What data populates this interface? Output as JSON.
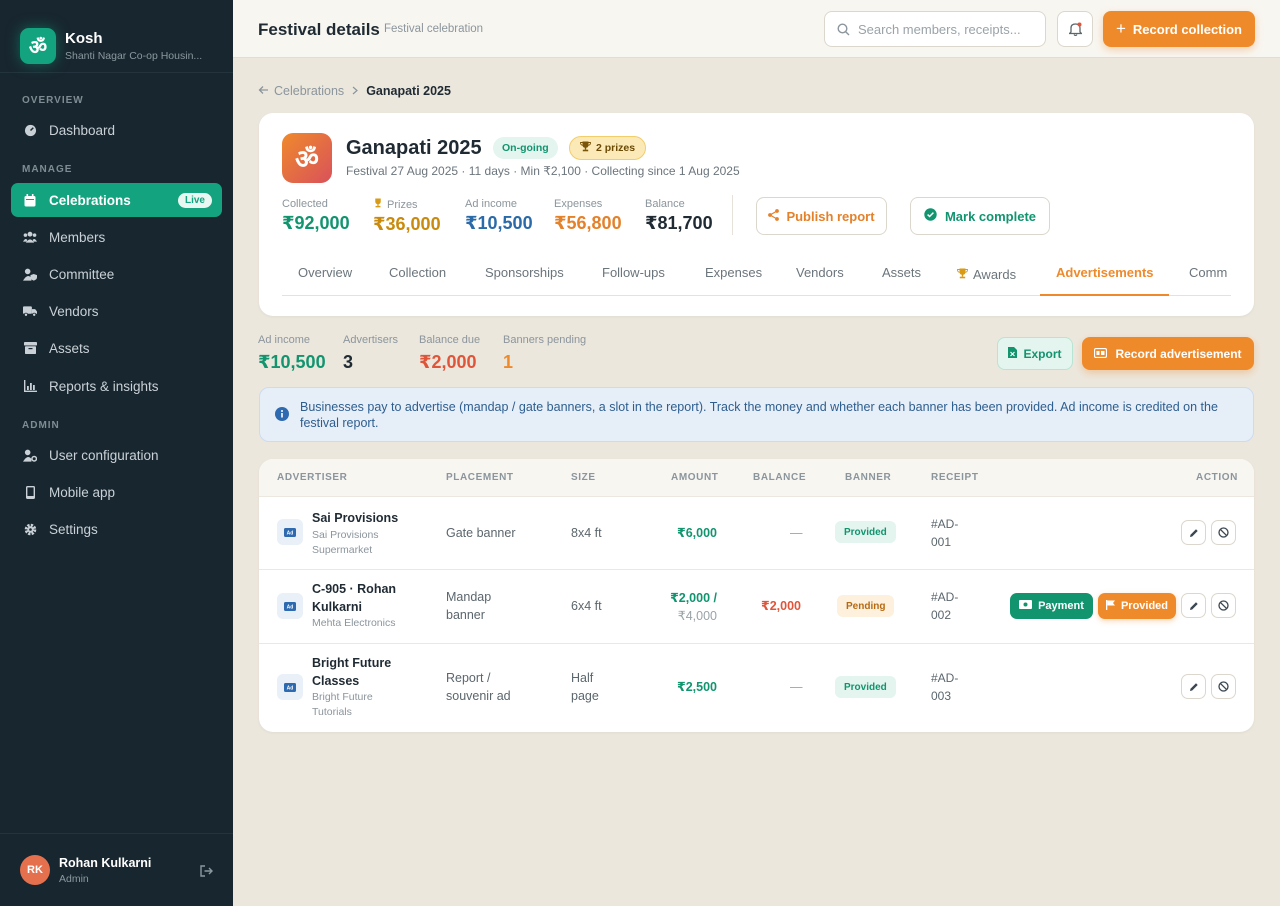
{
  "sidebar": {
    "brand_name": "Kosh",
    "brand_glyph": "ॐ",
    "brand_sub": "Shanti Nagar Co-op Housin...",
    "sections": [
      "OVERVIEW",
      "MANAGE",
      "ADMIN"
    ],
    "items": [
      {
        "label": "Dashboard",
        "icon": "gauge-icon"
      },
      {
        "label": "Celebrations",
        "icon": "calendar-icon",
        "badge": "Live"
      },
      {
        "label": "Members",
        "icon": "users-icon"
      },
      {
        "label": "Committee",
        "icon": "user-shield-icon"
      },
      {
        "label": "Vendors",
        "icon": "truck-icon"
      },
      {
        "label": "Assets",
        "icon": "box-icon"
      },
      {
        "label": "Reports & insights",
        "icon": "chart-icon"
      },
      {
        "label": "User configuration",
        "icon": "user-gear-icon"
      },
      {
        "label": "Mobile app",
        "icon": "phone-icon"
      },
      {
        "label": "Settings",
        "icon": "gear-icon"
      }
    ],
    "user": {
      "initials": "RK",
      "name": "Rohan Kulkarni",
      "role": "Admin"
    }
  },
  "topbar": {
    "title": "Festival details",
    "subtitle": "Festival celebration",
    "search_placeholder": "Search members, receipts...",
    "record_collection": "Record collection"
  },
  "breadcrumb": {
    "parent": "Celebrations",
    "current": "Ganapati 2025"
  },
  "festival": {
    "glyph": "ॐ",
    "name": "Ganapati 2025",
    "status": "On-going",
    "prizes_badge": "2 prizes",
    "meta": "Festival 27 Aug 2025 · 11 days · Min ₹2,100 · Collecting since 1 Aug 2025",
    "stats": [
      {
        "label": "Collected",
        "value": "₹92,000",
        "color": "#12946f"
      },
      {
        "label": "Prizes",
        "value": "₹36,000",
        "color": "#c98a0e"
      },
      {
        "label": "Ad income",
        "value": "₹10,500",
        "color": "#2a6aa8"
      },
      {
        "label": "Expenses",
        "value": "₹56,800",
        "color": "#e4812b"
      },
      {
        "label": "Balance",
        "value": "₹81,700",
        "color": "#1f2a33"
      }
    ],
    "publish_report": "Publish report",
    "mark_complete": "Mark complete",
    "tabs": [
      "Overview",
      "Collection",
      "Sponsorships",
      "Follow-ups",
      "Expenses",
      "Vendors",
      "Assets",
      "Awards",
      "Advertisements",
      "Comm"
    ],
    "active_tab": "Advertisements"
  },
  "summary": {
    "items": [
      {
        "label": "Ad income",
        "value": "₹10,500",
        "color": "#12946f"
      },
      {
        "label": "Advertisers",
        "value": "3",
        "color": "#1f2a33"
      },
      {
        "label": "Balance due",
        "value": "₹2,000",
        "color": "#e0553a"
      },
      {
        "label": "Banners pending",
        "value": "1",
        "color": "#ef8a2b"
      }
    ],
    "export": "Export",
    "record_ad": "Record advertisement"
  },
  "info": "Businesses pay to advertise (mandap / gate banners, a slot in the report). Track the money and whether each banner has been provided. Ad income is credited on the festival report.",
  "table": {
    "headers": [
      "ADVERTISER",
      "PLACEMENT",
      "SIZE",
      "AMOUNT",
      "BALANCE",
      "BANNER",
      "RECEIPT",
      "ACTION"
    ],
    "rows": [
      {
        "name": "Sai Provisions",
        "sub": "Sai Provisions Supermarket",
        "placement": "Gate banner",
        "size": "8x4 ft",
        "amount": "₹6,000",
        "amount_total": "",
        "balance": "—",
        "banner": "Provided",
        "receipt": "#AD-001"
      },
      {
        "name": "C-905 · Rohan Kulkarni",
        "sub": "Mehta Electronics",
        "placement": "Mandap banner",
        "size": "6x4 ft",
        "amount": "₹2,000 /",
        "amount_total": "₹4,000",
        "balance": "₹2,000",
        "banner": "Pending",
        "receipt": "#AD-002",
        "payment": "Payment",
        "provided": "Provided"
      },
      {
        "name": "Bright Future Classes",
        "sub": "Bright Future Tutorials",
        "placement": "Report / souvenir ad",
        "size": "Half page",
        "amount": "₹2,500",
        "amount_total": "",
        "balance": "—",
        "banner": "Provided",
        "receipt": "#AD-003"
      }
    ]
  }
}
